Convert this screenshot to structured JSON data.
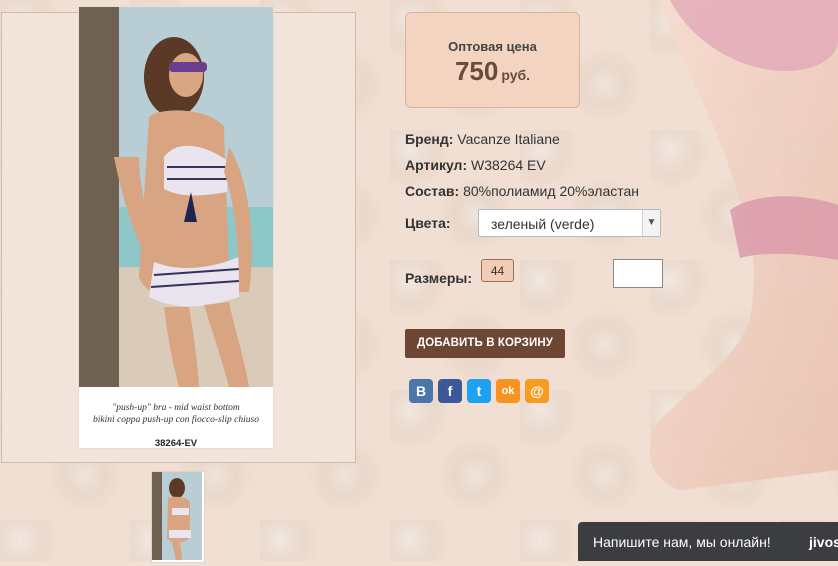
{
  "price": {
    "caption": "Оптовая цена",
    "amount": "750",
    "currency": "руб."
  },
  "product": {
    "brand_label": "Бренд:",
    "brand": "Vacanze Italiane",
    "article_label": "Артикул:",
    "article": "W38264 EV",
    "composition_label": "Состав:",
    "composition": "80%полиамид 20%эластан"
  },
  "colors": {
    "label": "Цвета:",
    "selected": "зеленый (verde)"
  },
  "sizes": {
    "label": "Размеры:",
    "options": [
      "44"
    ]
  },
  "cart": {
    "add_label": "ДОБАВИТЬ В КОРЗИНУ"
  },
  "photo": {
    "caption_line1": "\"push-up\" bra - mid waist bottom",
    "caption_line2": "bikini coppa push-up con fiocco-slip chiuso",
    "code": "38264-EV"
  },
  "share": [
    {
      "name": "vk",
      "glyph": "В",
      "color": "#4a76a8"
    },
    {
      "name": "facebook",
      "glyph": "f",
      "color": "#3b5998"
    },
    {
      "name": "twitter",
      "glyph": "t",
      "color": "#1da1f2"
    },
    {
      "name": "odnoklassniki",
      "glyph": "ok",
      "color": "#f7931e"
    },
    {
      "name": "mail",
      "glyph": "@",
      "color": "#f79c1e"
    }
  ],
  "chat": {
    "message": "Напишите нам, мы онлайн!",
    "brand": "jivos"
  }
}
